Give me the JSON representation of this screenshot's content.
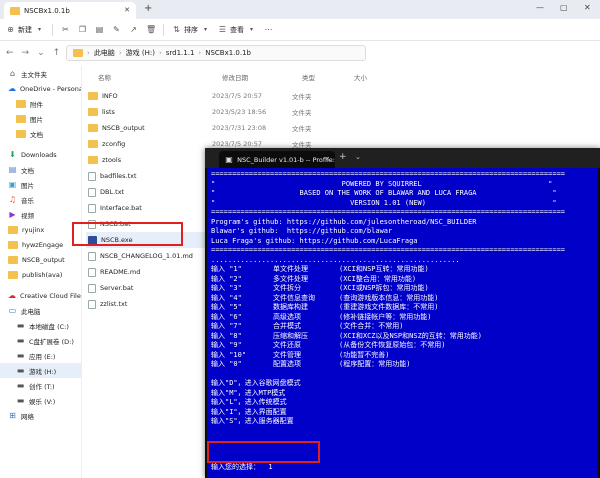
{
  "explorer": {
    "tab_title": "NSCBx1.0.1b",
    "toolbar": {
      "new_label": "新建",
      "sort_label": "排序",
      "view_label": "查看"
    },
    "breadcrumbs": [
      "此电脑",
      "游戏 (H:)",
      "srd1.1.1",
      "NSCBx1.0.1b"
    ],
    "columns": {
      "name": "名称",
      "date": "修改日期",
      "type": "类型",
      "size": "大小"
    },
    "sidebar": [
      {
        "label": "主文件夹",
        "icon": "home-icon"
      },
      {
        "label": "OneDrive - Persona",
        "icon": "cloud-icon"
      },
      {
        "label": "附件",
        "icon": "folder-icon"
      },
      {
        "label": "图片",
        "icon": "folder-icon"
      },
      {
        "label": "文档",
        "icon": "folder-icon"
      },
      {
        "label": "Downloads",
        "icon": "download-icon"
      },
      {
        "label": "文档",
        "icon": "document-icon"
      },
      {
        "label": "图片",
        "icon": "picture-icon"
      },
      {
        "label": "音乐",
        "icon": "music-icon"
      },
      {
        "label": "视频",
        "icon": "video-icon"
      },
      {
        "label": "ryujinx",
        "icon": "folder-icon"
      },
      {
        "label": "hywzEngage",
        "icon": "folder-icon"
      },
      {
        "label": "NSCB_output",
        "icon": "folder-icon"
      },
      {
        "label": "publish(ava)",
        "icon": "folder-icon"
      },
      {
        "label": "Creative Cloud Files",
        "icon": "cloud-icon"
      },
      {
        "label": "此电脑",
        "icon": "computer-icon"
      },
      {
        "label": "本地磁盘 (C:)",
        "icon": "drive-icon"
      },
      {
        "label": "C盘扩展卷 (D:)",
        "icon": "drive-icon"
      },
      {
        "label": "应用 (E:)",
        "icon": "drive-icon"
      },
      {
        "label": "游戏 (H:)",
        "icon": "drive-icon"
      },
      {
        "label": "创作 (T:)",
        "icon": "drive-icon"
      },
      {
        "label": "娱乐 (V:)",
        "icon": "drive-icon"
      },
      {
        "label": "网络",
        "icon": "network-icon"
      }
    ],
    "files": [
      {
        "name": "INFO",
        "date": "2023/7/5 20:57",
        "type": "文件夹",
        "kind": "folder"
      },
      {
        "name": "lists",
        "date": "2023/5/23 18:56",
        "type": "文件夹",
        "kind": "folder"
      },
      {
        "name": "NSCB_output",
        "date": "2023/7/31 23:08",
        "type": "文件夹",
        "kind": "folder"
      },
      {
        "name": "zconfig",
        "date": "2023/7/5 20:57",
        "type": "文件夹",
        "kind": "folder"
      },
      {
        "name": "ztools",
        "date": "",
        "type": "",
        "kind": "folder"
      },
      {
        "name": "badfiles.txt",
        "date": "",
        "type": "",
        "kind": "file"
      },
      {
        "name": "DBL.txt",
        "date": "",
        "type": "",
        "kind": "file"
      },
      {
        "name": "Interface.bat",
        "date": "",
        "type": "",
        "kind": "file"
      },
      {
        "name": "NSCB.bat",
        "date": "",
        "type": "",
        "kind": "file"
      },
      {
        "name": "NSCB.exe",
        "date": "",
        "type": "",
        "kind": "exe"
      },
      {
        "name": "NSCB_CHANGELOG_1.01.md",
        "date": "",
        "type": "",
        "kind": "file"
      },
      {
        "name": "README.md",
        "date": "",
        "type": "",
        "kind": "file"
      },
      {
        "name": "Server.bat",
        "date": "",
        "type": "",
        "kind": "file"
      },
      {
        "name": "zzlist.txt",
        "date": "",
        "type": "",
        "kind": "file"
      }
    ]
  },
  "terminal": {
    "tab_title": "NSC_Builder v1.01-b -- Profile:",
    "header": {
      "rule": "====================================================================================",
      "line1": "\"                              POWERED BY SQUIRREL                              \"",
      "line2": "\"                    BASED ON THE WORK OF BLAWAR AND LUCA FRAGA                  \"",
      "line3": "\"                                VERSION 1.01 (NEW)                              \""
    },
    "links": [
      "Program's github: https://github.com/julesontheroad/NSC_BUILDER",
      "Blawar's github:  https://github.com/blawar",
      "Luca Fraga's github: https://github.com/LucaFraga"
    ],
    "dots": "...........................................................",
    "menu": [
      {
        "key": "输入 \"1\"",
        "name": "单文件处理",
        "desc": "(XCI和NSP互转：常用功能)"
      },
      {
        "key": "输入 \"2\"",
        "name": "多文件处理",
        "desc": "(XCI整合用：常用功能)"
      },
      {
        "key": "输入 \"3\"",
        "name": "文件拆分",
        "desc": "(XCI或NSP拆包：常用功能)"
      },
      {
        "key": "输入 \"4\"",
        "name": "文件信息查询",
        "desc": "(查询游戏版本信息：常用功能)"
      },
      {
        "key": "输入 \"5\"",
        "name": "数据库构建",
        "desc": "(重建游戏文件数据库：不常用)"
      },
      {
        "key": "输入 \"6\"",
        "name": "高级选项",
        "desc": "(修补链接帐户等：常用功能)"
      },
      {
        "key": "输入 \"7\"",
        "name": "合并模式",
        "desc": "(文件合并：不常用)"
      },
      {
        "key": "输入 \"8\"",
        "name": "压缩和解压",
        "desc": "(XCI和XCZ以及NSP和NSZ的互转：常用功能)"
      },
      {
        "key": "输入 \"9\"",
        "name": "文件还原",
        "desc": "(从备份文件恢复原始包：不常用)"
      },
      {
        "key": "输入 \"10\"",
        "name": "文件管理",
        "desc": "(功能暂不完善)"
      },
      {
        "key": "输入 \"0\"",
        "name": "配置选项",
        "desc": "(程序配置：常用功能)"
      }
    ],
    "modes": [
      "输入\"D\"，进入谷歌网盘模式",
      "输入\"M\"，进入MTP模式",
      "输入\"L\"，进入传统模式",
      "输入\"I\"，进入界面配置",
      "输入\"S\"，进入服务器配置"
    ],
    "prompt": "输入您的选择：  1",
    "bg_color": "#0000c8"
  }
}
